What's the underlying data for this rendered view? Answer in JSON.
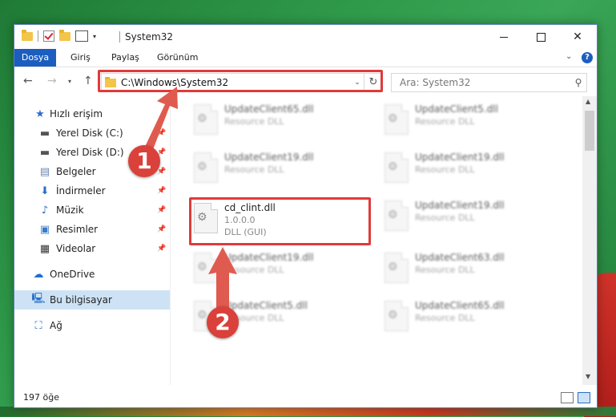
{
  "window": {
    "title": "System32"
  },
  "ribbon": {
    "tabs": [
      "Dosya",
      "Giriş",
      "Paylaş",
      "Görünüm"
    ]
  },
  "address": {
    "path": "C:\\Windows\\System32"
  },
  "search": {
    "placeholder": "Ara: System32"
  },
  "sidebar": {
    "items": [
      {
        "label": "Hızlı erişim",
        "icon": "star-icon"
      },
      {
        "label": "Yerel Disk (C:)",
        "icon": "drive-icon",
        "pinned": true
      },
      {
        "label": "Yerel Disk (D:)",
        "icon": "drive-icon",
        "pinned": true
      },
      {
        "label": "Belgeler",
        "icon": "document-icon",
        "pinned": true
      },
      {
        "label": "İndirmeler",
        "icon": "download-icon",
        "pinned": true
      },
      {
        "label": "Müzik",
        "icon": "music-icon",
        "pinned": true
      },
      {
        "label": "Resimler",
        "icon": "pictures-icon",
        "pinned": true
      },
      {
        "label": "Videolar",
        "icon": "video-icon",
        "pinned": true
      },
      {
        "label": "OneDrive",
        "icon": "cloud-icon"
      },
      {
        "label": "Bu bilgisayar",
        "icon": "computer-icon",
        "selected": true
      },
      {
        "label": "Ağ",
        "icon": "network-icon"
      }
    ]
  },
  "files": [
    {
      "name": "UpdateClient65.dll",
      "type": "Resource DLL"
    },
    {
      "name": "UpdateClient5.dll",
      "type": "Resource DLL"
    },
    {
      "name": "UpdateClient19.dll",
      "type": "Resource DLL"
    },
    {
      "name": "UpdateClient19.dll",
      "type": "Resource DLL"
    },
    {
      "name": "cd_clint.dll",
      "version": "1.0.0.0",
      "type": "DLL (GUI)"
    },
    {
      "name": "UpdateClient19.dll",
      "type": "Resource DLL"
    },
    {
      "name": "UpdateClient19.dll",
      "type": "Resource DLL"
    },
    {
      "name": "UpdateClient63.dll",
      "type": "Resource DLL"
    },
    {
      "name": "UpdateClient5.dll",
      "type": "Resource DLL"
    },
    {
      "name": "UpdateClient65.dll",
      "type": "Resource DLL"
    }
  ],
  "status": {
    "count": "197 öğe"
  },
  "callouts": [
    "1",
    "2"
  ],
  "colors": {
    "accent": "#1c5ebf",
    "highlight": "#e03a3a",
    "selected": "#cde3f5"
  }
}
